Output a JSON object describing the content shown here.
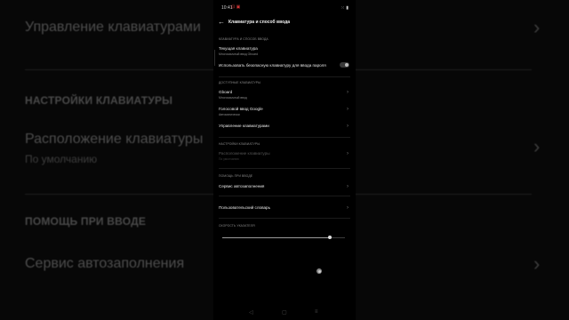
{
  "background": {
    "manage_keyboards": "Управление клавиатурами",
    "keyboard_settings_header": "НАСТРОЙКИ КЛАВИАТУРЫ",
    "keyboard_layout": "Расположение клавиатуры",
    "keyboard_layout_value": "По умолчанию",
    "input_help_header": "ПОМОЩЬ ПРИ ВВОДЕ",
    "autofill_service": "Сервис автозаполнения"
  },
  "statusbar": {
    "time": "10:41",
    "icons": "⊡ ▣",
    "right": "⁙ ▮"
  },
  "appbar": {
    "title": "Клавиатура и способ ввода"
  },
  "sections": {
    "keyboards_and_input": "КЛАВИАТУРА И СПОСОБ ВВОДА",
    "available_keyboards": "ДОСТУПНЫЕ КЛАВИАТУРЫ",
    "keyboard_settings": "НАСТРОЙКИ КЛАВИАТУРЫ",
    "input_help": "ПОМОЩЬ ПРИ ВВОДЕ",
    "pointer_speed": "СКОРОСТЬ УКАЗАТЕЛЯ"
  },
  "items": {
    "current_keyboard": {
      "label": "Текущая клавиатура",
      "sub": "Многоязычный ввод Gboard"
    },
    "secure_keyboard": {
      "label": "Использовать безопасную клавиатуру для ввода пароля",
      "enabled": false
    },
    "gboard": {
      "label": "Gboard",
      "sub": "Многоязычный ввод"
    },
    "google_voice": {
      "label": "Голосовой ввод Google",
      "sub": "Автоматически"
    },
    "manage_keyboards": {
      "label": "Управление клавиатурами"
    },
    "keyboard_layout": {
      "label": "Расположение клавиатуры",
      "sub": "По умолчанию"
    },
    "autofill": {
      "label": "Сервис автозаполнения"
    },
    "user_dictionary": {
      "label": "Пользовательский словарь"
    }
  },
  "pointer_speed": {
    "value": 0.88
  },
  "navbar": {
    "back": "◁",
    "home": "▢",
    "recents": "≡"
  }
}
